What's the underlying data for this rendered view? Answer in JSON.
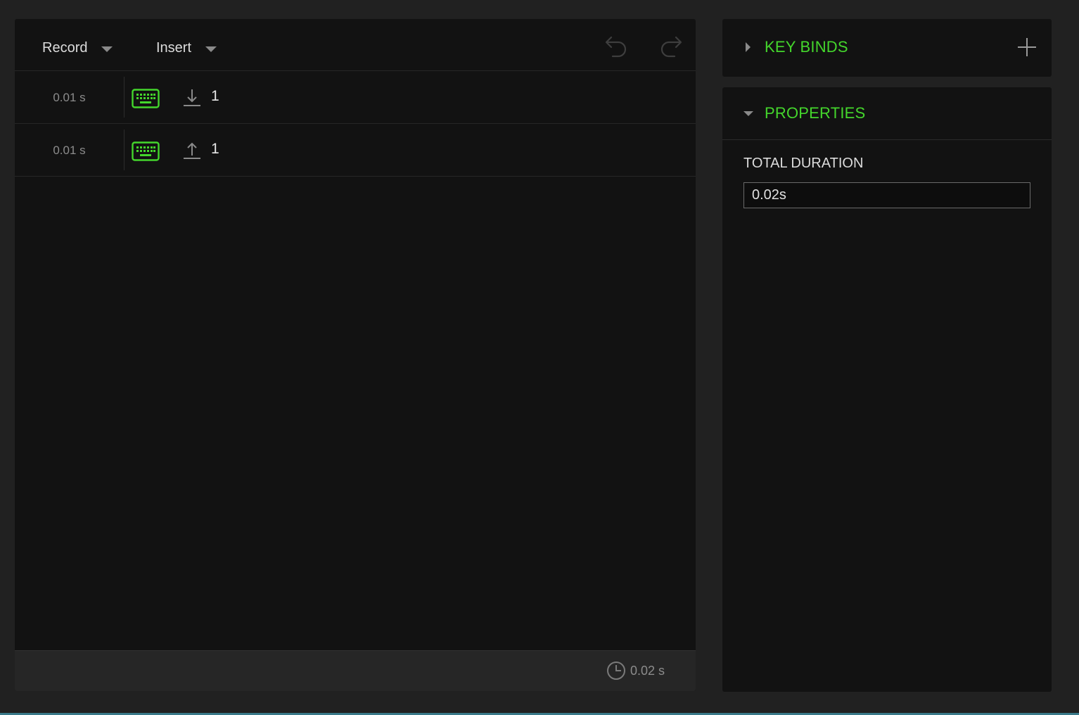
{
  "toolbar": {
    "record_label": "Record",
    "insert_label": "Insert"
  },
  "events": [
    {
      "delay": "0.01 s",
      "device": "keyboard-icon",
      "action": "key-down",
      "key": "1"
    },
    {
      "delay": "0.01 s",
      "device": "keyboard-icon",
      "action": "key-up",
      "key": "1"
    }
  ],
  "footer": {
    "total_time": "0.02 s"
  },
  "keybinds": {
    "title": "KEY BINDS"
  },
  "properties": {
    "title": "PROPERTIES",
    "total_duration_label": "TOTAL DURATION",
    "total_duration_value": "0.02s"
  },
  "colors": {
    "accent": "#44d62c",
    "panel_bg": "#121212",
    "page_bg": "#212121"
  }
}
